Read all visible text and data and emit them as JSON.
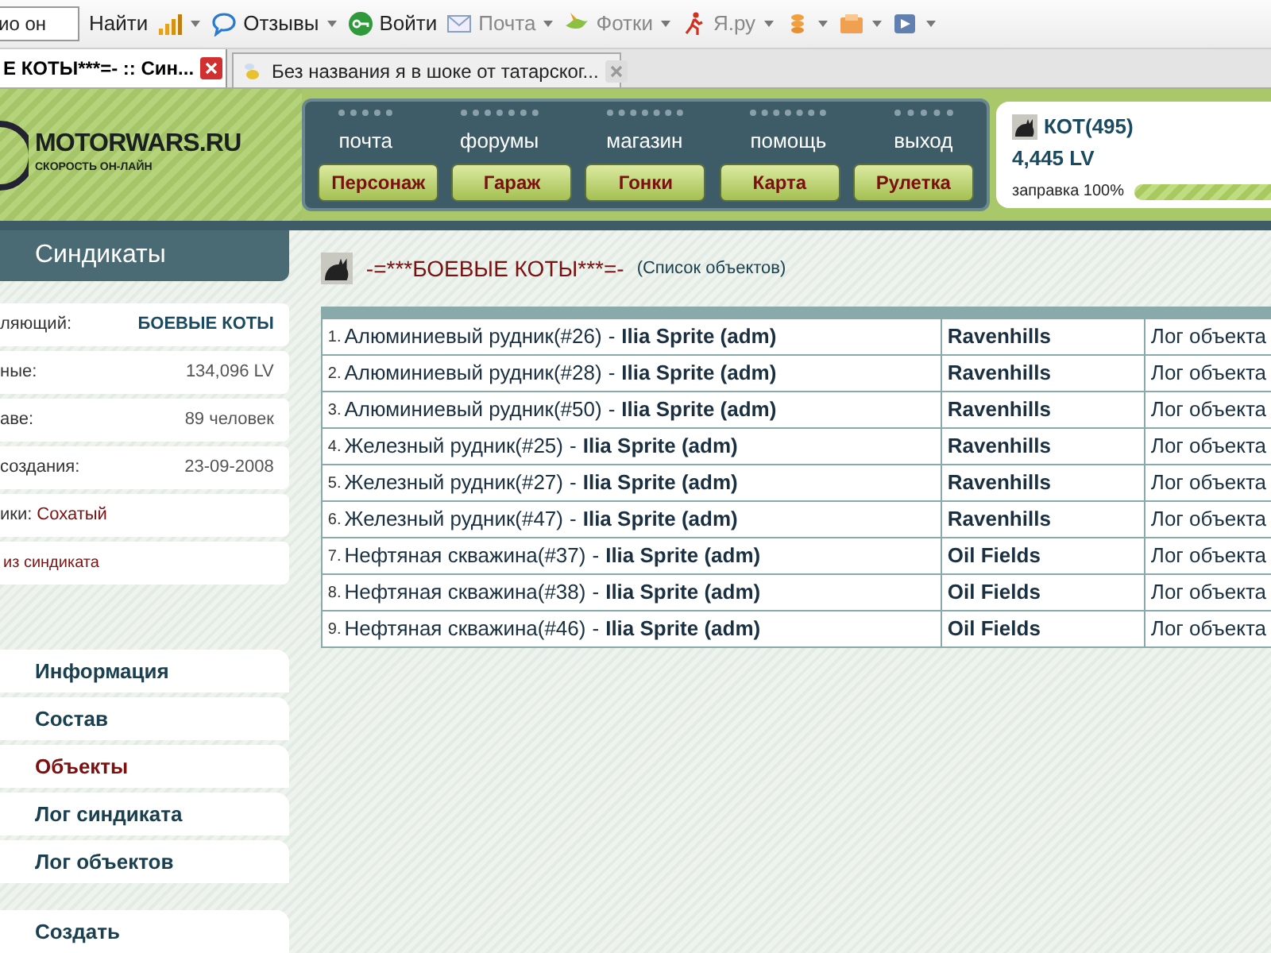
{
  "toolbar": {
    "search_value": "ио он",
    "items": [
      {
        "kind": "button",
        "label": "Найти"
      },
      {
        "kind": "signal"
      },
      {
        "kind": "speech",
        "label": "Отзывы"
      },
      {
        "kind": "key",
        "label": "Войти"
      },
      {
        "kind": "mail",
        "label": "Почта"
      },
      {
        "kind": "bird",
        "label": "Фотки"
      },
      {
        "kind": "runner",
        "label": "Я.ру"
      },
      {
        "kind": "coins"
      },
      {
        "kind": "box"
      },
      {
        "kind": "arrow"
      }
    ]
  },
  "browser_tabs": [
    {
      "title": "Е КОТЫ***=- :: Син...",
      "selected": true
    },
    {
      "title": "Без названия я в шоке от татарског...",
      "selected": false
    }
  ],
  "header": {
    "logo": "MOTORWARS.RU",
    "tagline": "СКОРОСТЬ ОН-ЛАЙН",
    "nav_links": [
      "почта",
      "форумы",
      "магазин",
      "помощь",
      "выход"
    ],
    "nav_buttons": [
      "Персонаж",
      "Гараж",
      "Гонки",
      "Карта",
      "Рулетка"
    ],
    "user": {
      "name": "КОТ(495)",
      "balance": "4,445 LV",
      "fuel_label": "заправка 100%",
      "level": 1
    }
  },
  "sidebar": {
    "title": "Синдикаты",
    "info": [
      {
        "kind": "pair",
        "label": "ляющий:",
        "value": "БОЕВЫЕ КОТЫ",
        "strong": true
      },
      {
        "kind": "pair",
        "label": "ные:",
        "value": "134,096 LV",
        "strong": false
      },
      {
        "kind": "pair",
        "label": "аве:",
        "value": "89 человек",
        "strong": false
      },
      {
        "kind": "pair",
        "label": "создания:",
        "value": "23-09-2008",
        "strong": false
      },
      {
        "kind": "link",
        "label": "ики:",
        "value": "Сохатый"
      },
      {
        "kind": "action",
        "value": "из синдиката"
      }
    ],
    "menu": [
      {
        "label": "Информация",
        "selected": false
      },
      {
        "label": "Состав",
        "selected": false
      },
      {
        "label": "Объекты",
        "selected": true
      },
      {
        "label": "Лог синдиката",
        "selected": false
      },
      {
        "label": "Лог объектов",
        "selected": false
      }
    ],
    "create": "Создать"
  },
  "content": {
    "title": "-=***БОЕВЫЕ КОТЫ***=-",
    "subtitle": "(Список объектов)",
    "rows": [
      {
        "number": "1.",
        "object": "Алюминиевый рудник(#26)",
        "separator": "-",
        "owner": "Ilia Sprite (adm)",
        "location": "Ravenhills",
        "log": "Лог объекта"
      },
      {
        "number": "2.",
        "object": "Алюминиевый рудник(#28)",
        "separator": "-",
        "owner": "Ilia Sprite (adm)",
        "location": "Ravenhills",
        "log": "Лог объекта"
      },
      {
        "number": "3.",
        "object": "Алюминиевый рудник(#50)",
        "separator": "-",
        "owner": "Ilia Sprite (adm)",
        "location": "Ravenhills",
        "log": "Лог объекта"
      },
      {
        "number": "4.",
        "object": "Железный рудник(#25)",
        "separator": "-",
        "owner": "Ilia Sprite (adm)",
        "location": "Ravenhills",
        "log": "Лог объекта"
      },
      {
        "number": "5.",
        "object": "Железный рудник(#27)",
        "separator": "-",
        "owner": "Ilia Sprite (adm)",
        "location": "Ravenhills",
        "log": "Лог объекта"
      },
      {
        "number": "6.",
        "object": "Железный рудник(#47)",
        "separator": "-",
        "owner": "Ilia Sprite (adm)",
        "location": "Ravenhills",
        "log": "Лог объекта"
      },
      {
        "number": "7.",
        "object": "Нефтяная скважина(#37)",
        "separator": "-",
        "owner": "Ilia Sprite (adm)",
        "location": "Oil Fields",
        "log": "Лог объекта"
      },
      {
        "number": "8.",
        "object": "Нефтяная скважина(#38)",
        "separator": "-",
        "owner": "Ilia Sprite (adm)",
        "location": "Oil Fields",
        "log": "Лог объекта"
      },
      {
        "number": "9.",
        "object": "Нефтяная скважина(#46)",
        "separator": "-",
        "owner": "Ilia Sprite (adm)",
        "location": "Oil Fields",
        "log": "Лог объекта"
      }
    ]
  }
}
